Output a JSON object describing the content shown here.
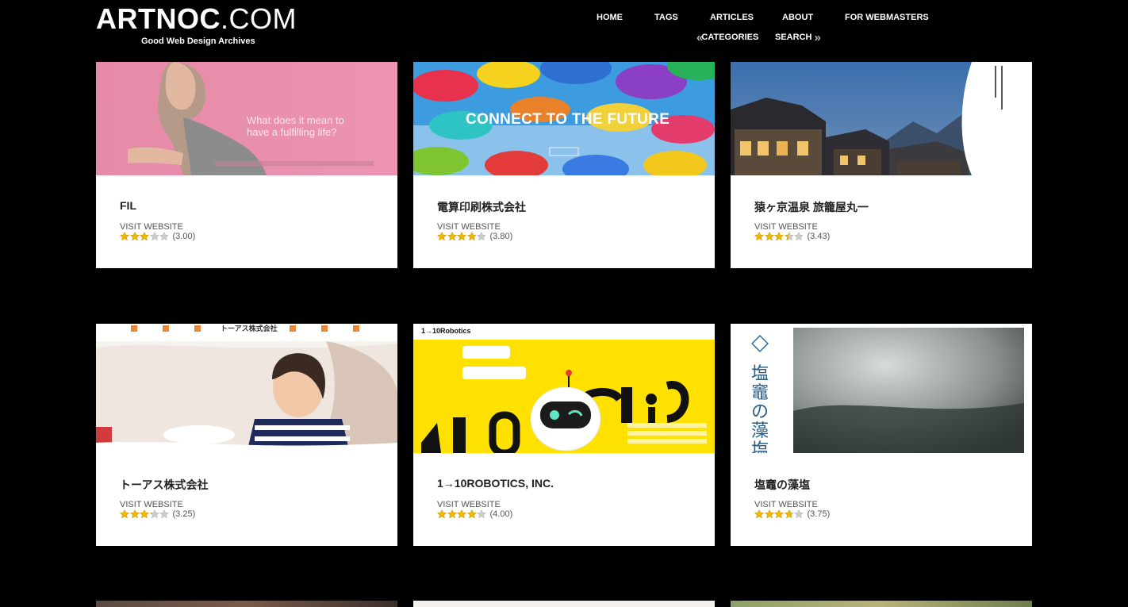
{
  "site": {
    "logo_bold": "ARTNOC",
    "logo_light": ".COM",
    "tagline": "Good Web Design Archives"
  },
  "nav": {
    "home": "HOME",
    "tags": "TAGS",
    "articles": "ARTICLES",
    "about": "ABOUT",
    "webmasters": "FOR WEBMASTERS",
    "categories": "CATEGORIES",
    "search": "SEARCH"
  },
  "cards": [
    {
      "title": "FIL",
      "visit": "VISIT WEBSITE",
      "rating": 3.0,
      "score": "(3.00)",
      "thumb_text": "What does it mean to have a fulfilling life?"
    },
    {
      "title": "電算印刷株式会社",
      "visit": "VISIT WEBSITE",
      "rating": 3.8,
      "score": "(3.80)",
      "thumb_text": "CONNECT TO THE FUTURE"
    },
    {
      "title": "猿ヶ京温泉 旅籠屋丸一",
      "visit": "VISIT WEBSITE",
      "rating": 3.43,
      "score": "(3.43)",
      "thumb_text": ""
    },
    {
      "title": "トーアス株式会社",
      "visit": "VISIT WEBSITE",
      "rating": 3.25,
      "score": "(3.25)",
      "thumb_text": "トーアス株式会社"
    },
    {
      "title": "1→10ROBOTICS, INC.",
      "visit": "VISIT WEBSITE",
      "rating": 4.0,
      "score": "(4.00)",
      "thumb_text": "1→10Robotics"
    },
    {
      "title": "塩竈の藻塩",
      "visit": "VISIT WEBSITE",
      "rating": 3.75,
      "score": "(3.75)",
      "thumb_text": "塩竈の藻塩"
    }
  ],
  "colors": {
    "background": "#000000",
    "card": "#ffffff",
    "star_fill": "#f2b705",
    "star_empty": "#cccccc"
  }
}
